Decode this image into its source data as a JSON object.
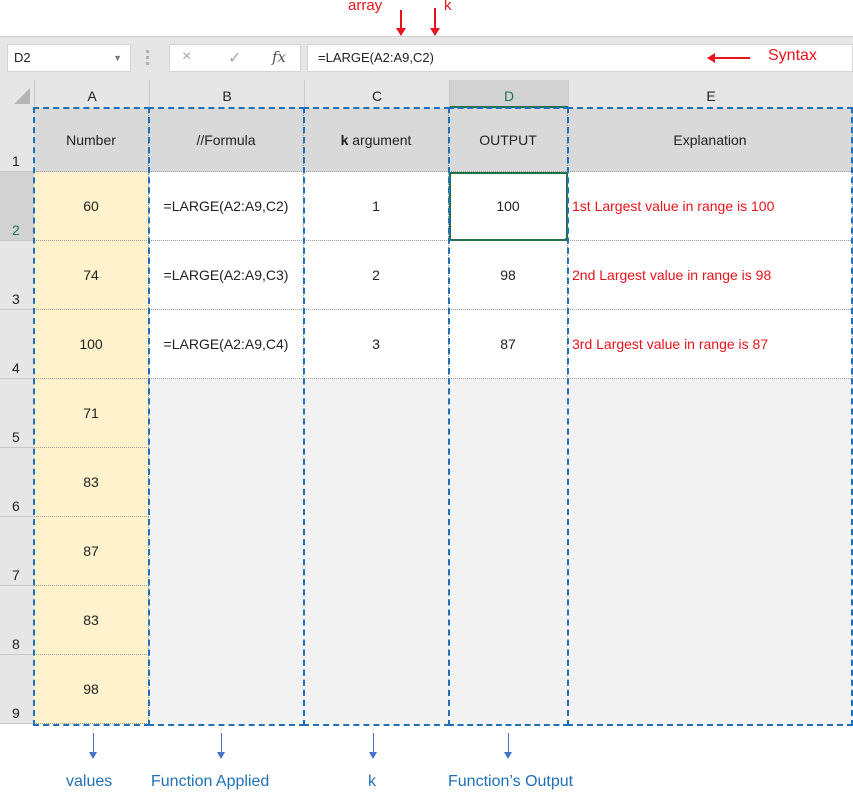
{
  "annotations": {
    "array_label": "array",
    "k_label": "k",
    "syntax_label": "Syntax",
    "bottom_labels": {
      "values": "values",
      "function_applied": "Function Applied",
      "k": "k",
      "function_output": "Function’s Output"
    },
    "colors": {
      "red": "#e8141c",
      "blue": "#1f70b8"
    }
  },
  "formula_bar": {
    "name_box": "D2",
    "cancel_icon": "×",
    "enter_icon": "✓",
    "fx_icon": "fx",
    "formula": "=LARGE(A2:A9,C2)"
  },
  "grid": {
    "columns": [
      "A",
      "B",
      "C",
      "D",
      "E"
    ],
    "selected_column": "D",
    "rows": [
      "1",
      "2",
      "3",
      "4",
      "5",
      "6",
      "7",
      "8",
      "9"
    ],
    "selected_row": "2",
    "headers": {
      "A": "Number",
      "B": "//Formula",
      "C_bold": "k",
      "C_rest": " argument",
      "D": "OUTPUT",
      "E": "Explanation"
    },
    "numbers": [
      "60",
      "74",
      "100",
      "71",
      "83",
      "87",
      "83",
      "98"
    ],
    "formulas": [
      "=LARGE(A2:A9,C2)",
      "=LARGE(A2:A9,C3)",
      "=LARGE(A2:A9,C4)"
    ],
    "k_values": [
      "1",
      "2",
      "3"
    ],
    "outputs": [
      "100",
      "98",
      "87"
    ],
    "explanations": [
      "1st Largest value in range is 100",
      "2nd Largest value in range is 98",
      "3rd Largest value in range is 87"
    ],
    "selected_cell": "D2",
    "colors": {
      "header_fill": "#d9d9d9",
      "values_fill": "#fff2cc",
      "selection": "#217346"
    }
  }
}
